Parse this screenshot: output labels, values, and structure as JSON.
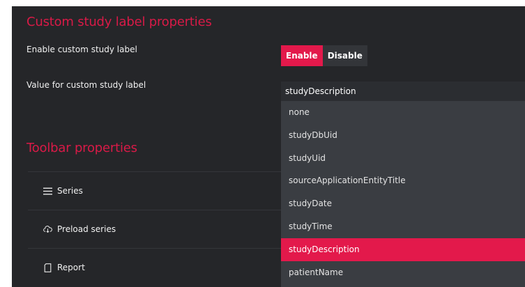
{
  "custom_study_label": {
    "title": "Custom study label properties",
    "enable_label": "Enable custom study label",
    "enable_button": "Enable",
    "disable_button": "Disable",
    "value_label": "Value for custom study label",
    "selected_value": "studyDescription",
    "options": [
      "none",
      "studyDbUid",
      "studyUid",
      "sourceApplicationEntityTitle",
      "studyDate",
      "studyTime",
      "studyDescription",
      "patientName"
    ]
  },
  "toolbar": {
    "title": "Toolbar properties",
    "items": [
      {
        "label": "Series",
        "icon": "hamburger-menu-icon"
      },
      {
        "label": "Preload series",
        "icon": "cloud-download-icon"
      },
      {
        "label": "Report",
        "icon": "document-icon"
      }
    ]
  },
  "colors": {
    "accent": "#e3194b",
    "panel_bg": "#252629",
    "dropdown_bg": "#3a3d42"
  }
}
